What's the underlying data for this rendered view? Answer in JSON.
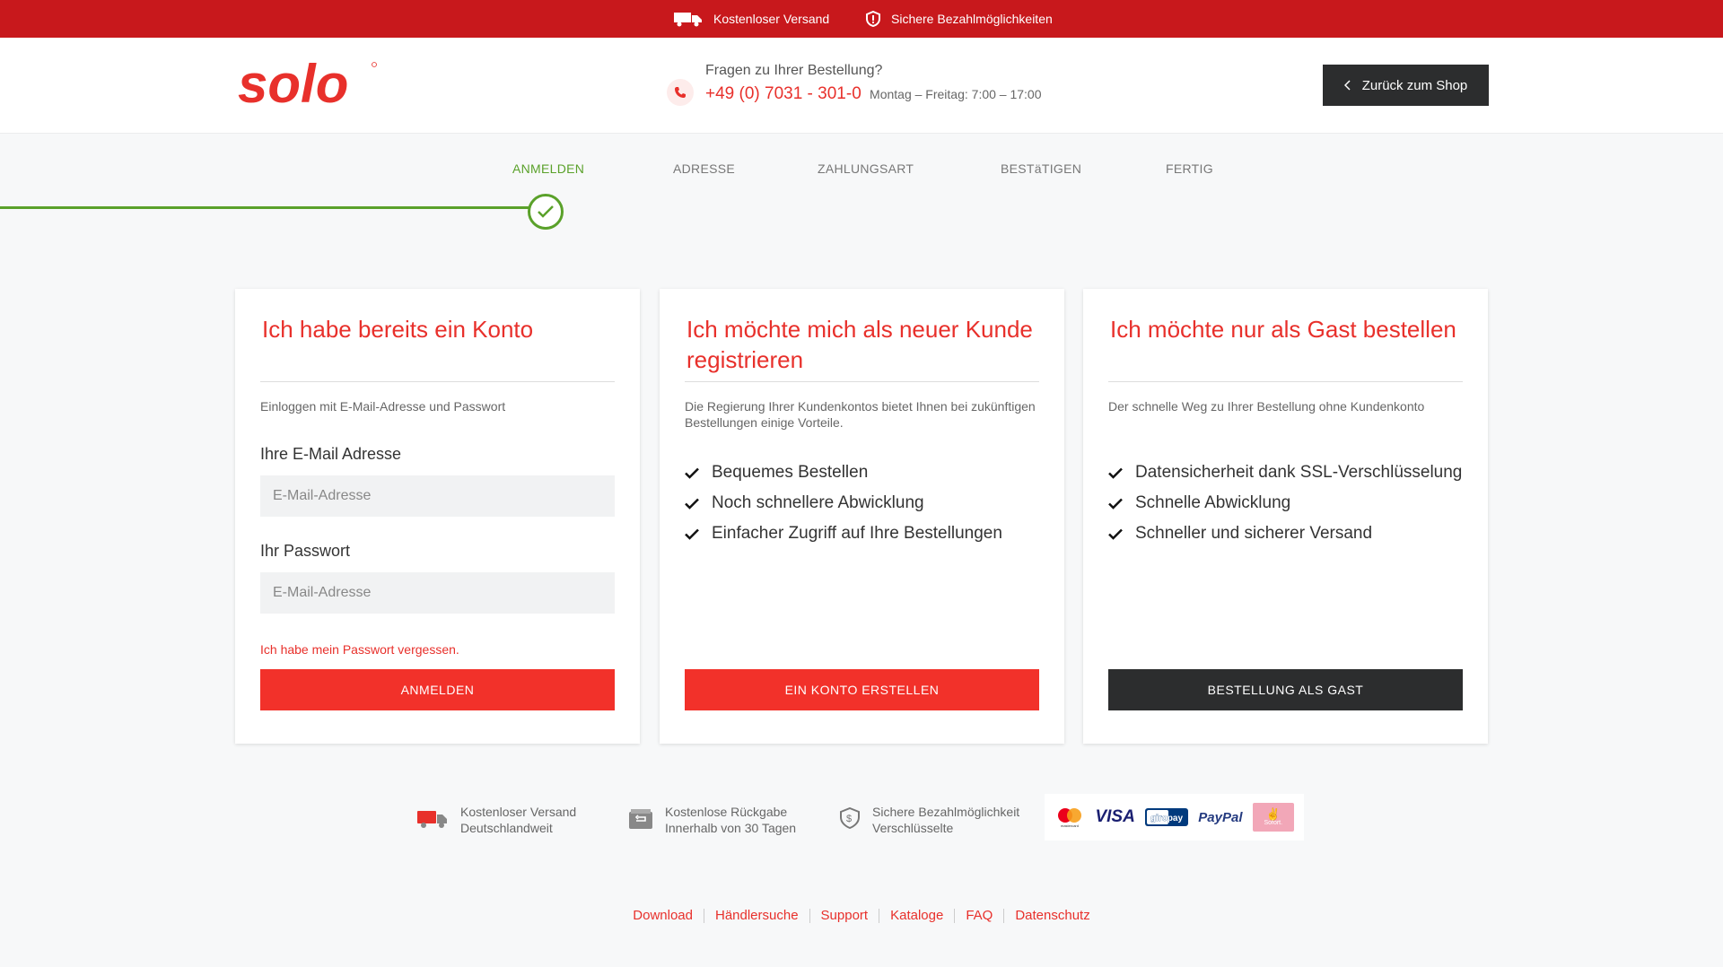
{
  "topbar": {
    "shipping": "Kostenloser Versand",
    "payment": "Sichere Bezahlmöglichkeiten"
  },
  "header": {
    "logo_text": "solo",
    "question": "Fragen zu Ihrer Bestellung?",
    "phone": "+49 (0) 7031 - 301-0",
    "hours": "Montag – Freitag: 7:00 – 17:00",
    "back_button": "Zurück zum Shop"
  },
  "steps": [
    "ANMELDEN",
    "ADRESSE",
    "ZAHLUNGSART",
    "BESTäTIGEN",
    "FERTIG"
  ],
  "login_card": {
    "title": "Ich habe bereits ein Konto",
    "desc": "Einloggen mit E-Mail-Adresse und Passwort",
    "email_label": "Ihre E-Mail Adresse",
    "email_placeholder": "E-Mail-Adresse",
    "password_label": "Ihr Passwort",
    "password_placeholder": "E-Mail-Adresse",
    "forgot": "Ich habe mein Passwort vergessen.",
    "button": "ANMELDEN"
  },
  "register_card": {
    "title": "Ich möchte mich als neuer Kunde registrieren",
    "desc": "Die Regierung Ihrer Kundenkontos bietet Ihnen bei zukünftigen Bestellungen einige Vorteile.",
    "features": [
      "Bequemes Bestellen",
      "Noch schnellere Abwicklung",
      "Einfacher Zugriff auf Ihre Bestellungen"
    ],
    "button": "EIN KONTO ERSTELLEN"
  },
  "guest_card": {
    "title": "Ich möchte nur als Gast bestellen",
    "desc": "Der schnelle Weg zu Ihrer Bestellung ohne Kundenkonto",
    "features": [
      "Datensicherheit dank SSL-Verschlüsselung",
      "Schnelle Abwicklung",
      "Schneller und sicherer Versand"
    ],
    "button": "BESTELLUNG ALS GAST"
  },
  "trust": [
    {
      "line1": "Kostenloser Versand",
      "line2": "Deutschlandweit",
      "icon": "truck-icon"
    },
    {
      "line1": "Kostenlose Rückgabe",
      "line2": "Innerhalb von 30 Tagen",
      "icon": "return-icon"
    },
    {
      "line1": "Sichere Bezahlmöglichkeit",
      "line2": "Verschlüsselte",
      "icon": "shield-icon"
    }
  ],
  "payments": {
    "mastercard": "mastercard",
    "visa": "VISA",
    "giropay": "giropay",
    "paypal": "PayPal",
    "sofort": "Sofort."
  },
  "footer": [
    "Download",
    "Händlersuche",
    "Support",
    "Kataloge",
    "FAQ",
    "Datenschutz"
  ],
  "colors": {
    "brand_red": "#e8302b",
    "topbar_red": "#c8181c",
    "success_green": "#5aa12a",
    "dark": "#2c2d2e"
  }
}
